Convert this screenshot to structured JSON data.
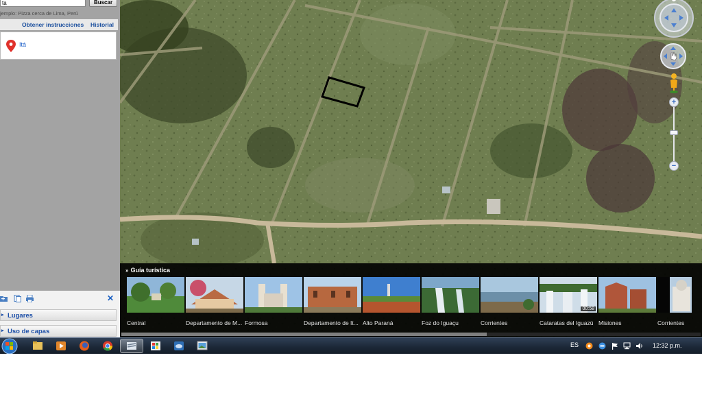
{
  "search": {
    "value": "ta",
    "button": "Buscar",
    "hint": "jemplo: Pizza cerca de Lima, Perú"
  },
  "links": {
    "directions": "Obtener instrucciones",
    "history": "Historial"
  },
  "result": {
    "place": "Itá"
  },
  "panel": {
    "places": "Lugares",
    "layers": "Uso de capas"
  },
  "icons": {
    "pin": "map-pin-icon",
    "add_folder": "add-folder-icon",
    "copy": "copy-icon",
    "print": "print-icon",
    "close": "close-icon"
  },
  "tour": {
    "title": "Guía turística",
    "items": [
      {
        "label": "Central"
      },
      {
        "label": "Departamento de M..."
      },
      {
        "label": "Formosa"
      },
      {
        "label": "Departamento de It..."
      },
      {
        "label": "Alto Paraná"
      },
      {
        "label": "Foz do Iguaçu"
      },
      {
        "label": "Corrientes"
      },
      {
        "label": "Cataratas del Iguazú",
        "duration": "00:58"
      },
      {
        "label": "Misiones"
      },
      {
        "label": ""
      },
      {
        "label": "Corrientes"
      }
    ]
  },
  "taskbar": {
    "language": "ES",
    "time": "12:32 p.m."
  },
  "colors": {
    "link": "#1b4f9e",
    "pin": "#e0312b",
    "taskbar": "#1b2736"
  }
}
